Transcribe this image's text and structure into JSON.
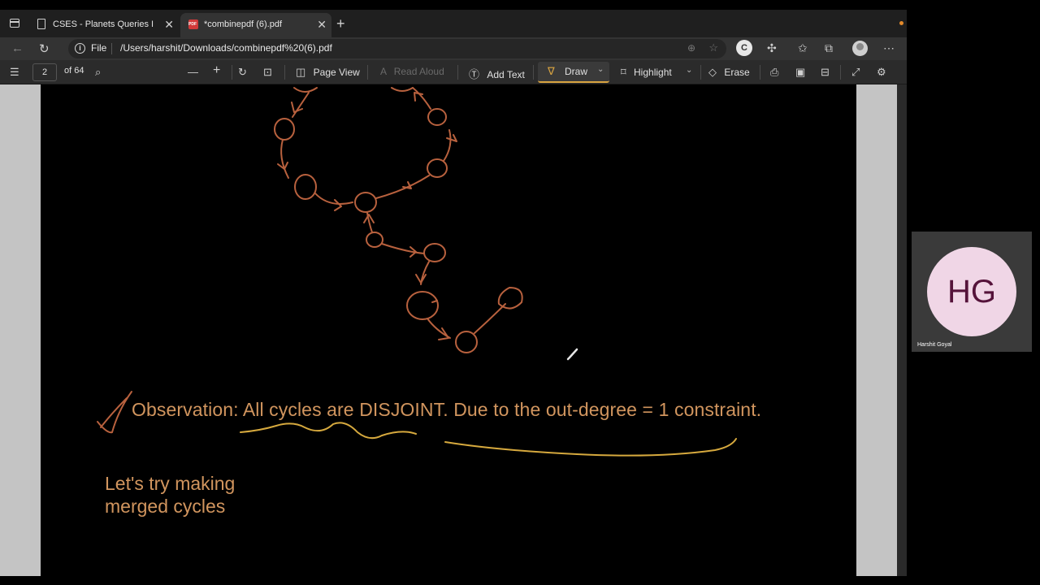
{
  "tabs": [
    {
      "title": "CSES - Planets Queries I",
      "close": "✕"
    },
    {
      "title": "*combinepdf (6).pdf",
      "close": "✕"
    }
  ],
  "new_tab": "+",
  "address": {
    "info": "i",
    "scheme_label": "File",
    "url": "/Users/harshit/Downloads/combinepdf%20(6).pdf",
    "extension_letter": "C"
  },
  "pdf_toolbar": {
    "page_current": "2",
    "page_total": "of 64",
    "page_view": "Page View",
    "read_aloud": "Read Aloud",
    "add_text": "Add Text",
    "draw": "Draw",
    "highlight": "Highlight",
    "erase": "Erase"
  },
  "document": {
    "observation": "Observation: All cycles are DISJOINT. Due to the out-degree = 1 constraint.",
    "note_line1": "Let's try making",
    "note_line2": "merged cycles"
  },
  "video": {
    "initials": "HG",
    "name": "Harshit Goyal"
  },
  "colors": {
    "ink_orange": "#b8613e",
    "ink_yellow": "#d6a93e",
    "text_orange": "#d1955e",
    "draw_active": "#d9a441",
    "avatar_bg": "#f0d6e6",
    "avatar_text": "#55133a"
  }
}
